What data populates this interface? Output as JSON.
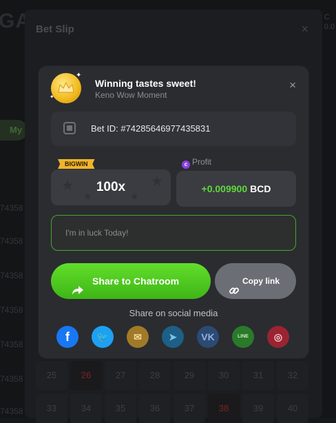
{
  "background": {
    "logo": "GA",
    "right_text": "C\n0.0",
    "my_tab": "My",
    "row_ids": [
      "74358",
      "74358",
      "74358",
      "74358",
      "74358",
      "74358",
      "74358",
      "74358"
    ],
    "grid_row1": [
      "25",
      "26",
      "27",
      "28",
      "29",
      "30",
      "31",
      "32"
    ],
    "grid_row2": [
      "33",
      "34",
      "35",
      "36",
      "37",
      "38",
      "39",
      "40"
    ]
  },
  "betslip": {
    "title": "Bet Slip",
    "close_glyph": "×"
  },
  "card": {
    "title": "Winning tastes sweet!",
    "subtitle": "Keno Wow Moment",
    "close_glyph": "×",
    "bet_id": "Bet ID: #74285646977435831",
    "bigwin_badge": "BIGWIN",
    "multiplier": "100x",
    "profit_label": "Profit",
    "profit_value": "+0.009900",
    "profit_unit": "BCD",
    "message_placeholder": "I'm in luck Today!",
    "share_label": "Share to Chatroom",
    "copy_label": "Copy link",
    "share_social_label": "Share on social media"
  },
  "social": [
    {
      "name": "facebook-icon",
      "glyph": "f",
      "color": "#1877f2",
      "fg": "#ffffff"
    },
    {
      "name": "twitter-icon",
      "glyph": "🐦",
      "color": "#1da1f2",
      "fg": "#ffffff"
    },
    {
      "name": "email-icon",
      "glyph": "✉",
      "color": "#a07a27",
      "fg": "#f1d493"
    },
    {
      "name": "telegram-icon",
      "glyph": "➤",
      "color": "#1d5f86",
      "fg": "#7bc3ea"
    },
    {
      "name": "vk-icon",
      "glyph": "VK",
      "color": "#2b4a74",
      "fg": "#8fb2e0"
    },
    {
      "name": "line-icon",
      "glyph": "LINE",
      "color": "#2a7a2a",
      "fg": "#bfe9bf"
    },
    {
      "name": "instagram-icon",
      "glyph": "◎",
      "color": "#9a2431",
      "fg": "#f1c7cc"
    }
  ],
  "colors": {
    "accent_green": "#5fd93a",
    "gold": "#f0b42c",
    "coin_purple": "#8c3fe0"
  }
}
